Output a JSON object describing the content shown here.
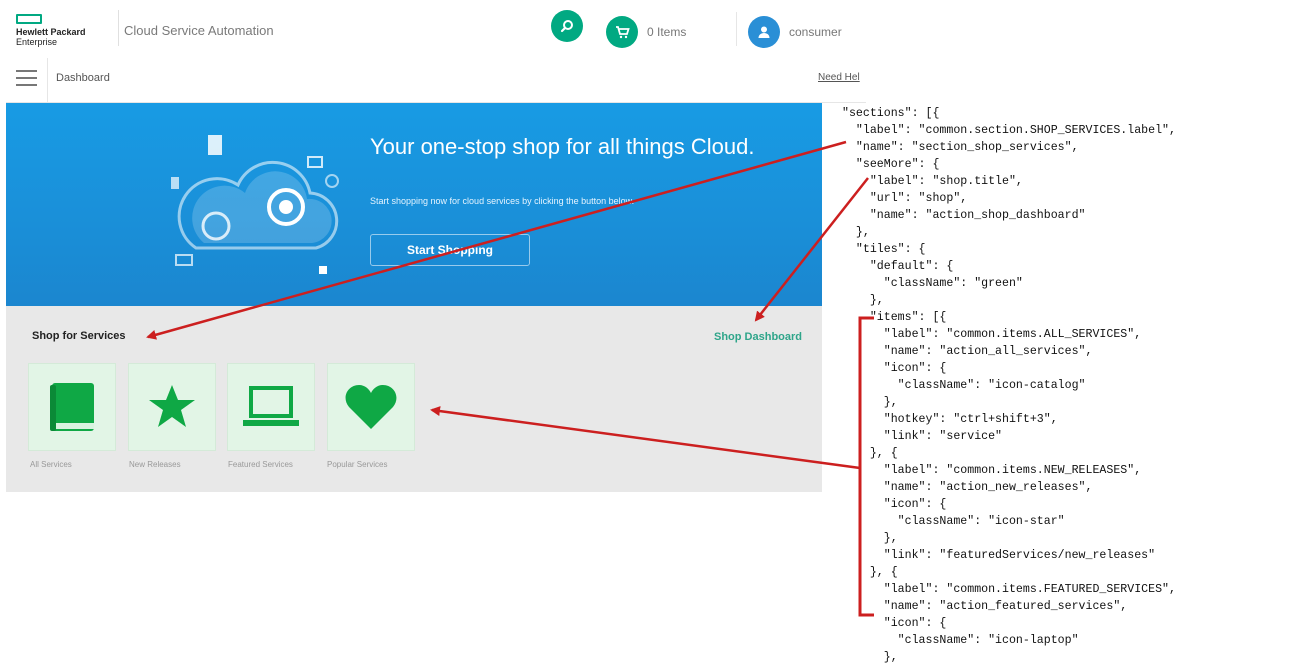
{
  "header": {
    "brand_line1": "Hewlett Packard",
    "brand_line2": "Enterprise",
    "app_title": "Cloud Service Automation",
    "cart_label": "0 Items",
    "user_label": "consumer"
  },
  "subbar": {
    "breadcrumb": "Dashboard",
    "help_link": "Need Hel"
  },
  "hero": {
    "title": "Your one-stop shop for all things Cloud.",
    "subtitle": "Start shopping now for cloud services by clicking the button below.",
    "button_label": "Start Shopping"
  },
  "shop": {
    "title": "Shop for Services",
    "see_more": "Shop Dashboard",
    "tiles": [
      {
        "label": "All Services",
        "icon": "book-icon"
      },
      {
        "label": "New Releases",
        "icon": "star-icon"
      },
      {
        "label": "Featured Services",
        "icon": "laptop-icon"
      },
      {
        "label": "Popular Services",
        "icon": "heart-icon"
      }
    ]
  },
  "code_lines": [
    "\"sections\": [{",
    "  \"label\": \"common.section.SHOP_SERVICES.label\",",
    "  \"name\": \"section_shop_services\",",
    "  \"seeMore\": {",
    "    \"label\": \"shop.title\",",
    "    \"url\": \"shop\",",
    "    \"name\": \"action_shop_dashboard\"",
    "  },",
    "  \"tiles\": {",
    "    \"default\": {",
    "      \"className\": \"green\"",
    "    },",
    "    \"items\": [{",
    "      \"label\": \"common.items.ALL_SERVICES\",",
    "      \"name\": \"action_all_services\",",
    "      \"icon\": {",
    "        \"className\": \"icon-catalog\"",
    "      },",
    "      \"hotkey\": \"ctrl+shift+3\",",
    "      \"link\": \"service\"",
    "    }, {",
    "      \"label\": \"common.items.NEW_RELEASES\",",
    "      \"name\": \"action_new_releases\",",
    "      \"icon\": {",
    "        \"className\": \"icon-star\"",
    "      },",
    "      \"link\": \"featuredServices/new_releases\"",
    "    }, {",
    "      \"label\": \"common.items.FEATURED_SERVICES\",",
    "      \"name\": \"action_featured_services\",",
    "      \"icon\": {",
    "        \"className\": \"icon-laptop\"",
    "      },"
  ],
  "colors": {
    "accent_green": "#01a982",
    "hero_blue": "#1a8fd8",
    "tile_icon_green": "#0fa845",
    "annotation_red": "#cc1f1f"
  }
}
